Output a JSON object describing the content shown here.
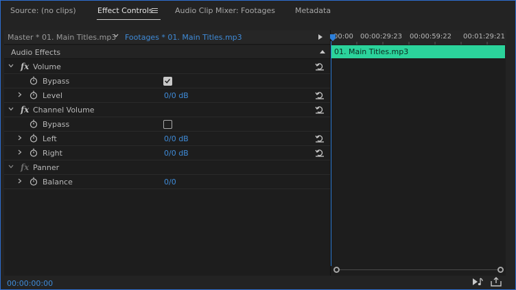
{
  "tabs": [
    {
      "label": "Source: (no clips)"
    },
    {
      "label": "Effect Controls"
    },
    {
      "label": "Audio Clip Mixer: Footages"
    },
    {
      "label": "Metadata"
    }
  ],
  "source": {
    "master_label": "Master * 01. Main Titles.mp3",
    "clip_label": "Footages * 01. Main Titles.mp3"
  },
  "section": {
    "label": "Audio Effects"
  },
  "effects": {
    "volume": {
      "name": "Volume",
      "bypass_label": "Bypass",
      "bypass_checked": true,
      "level_label": "Level",
      "level_value": "0/0 dB"
    },
    "channel_volume": {
      "name": "Channel Volume",
      "bypass_label": "Bypass",
      "bypass_checked": false,
      "left_label": "Left",
      "left_value": "0/0 dB",
      "right_label": "Right",
      "right_value": "0/0 dB"
    },
    "panner": {
      "name": "Panner",
      "balance_label": "Balance",
      "balance_value": "0/0"
    }
  },
  "timeline": {
    "ticks": [
      "00:00",
      "00:00:29:23",
      "00:00:59:22",
      "00:01:29:21"
    ],
    "clip_label": "01. Main Titles.mp3"
  },
  "footer": {
    "timecode": "00:00:00:00"
  },
  "colors": {
    "accent": "#2d7fd9",
    "clip": "#2bd39b",
    "value": "#3f8bd8"
  }
}
